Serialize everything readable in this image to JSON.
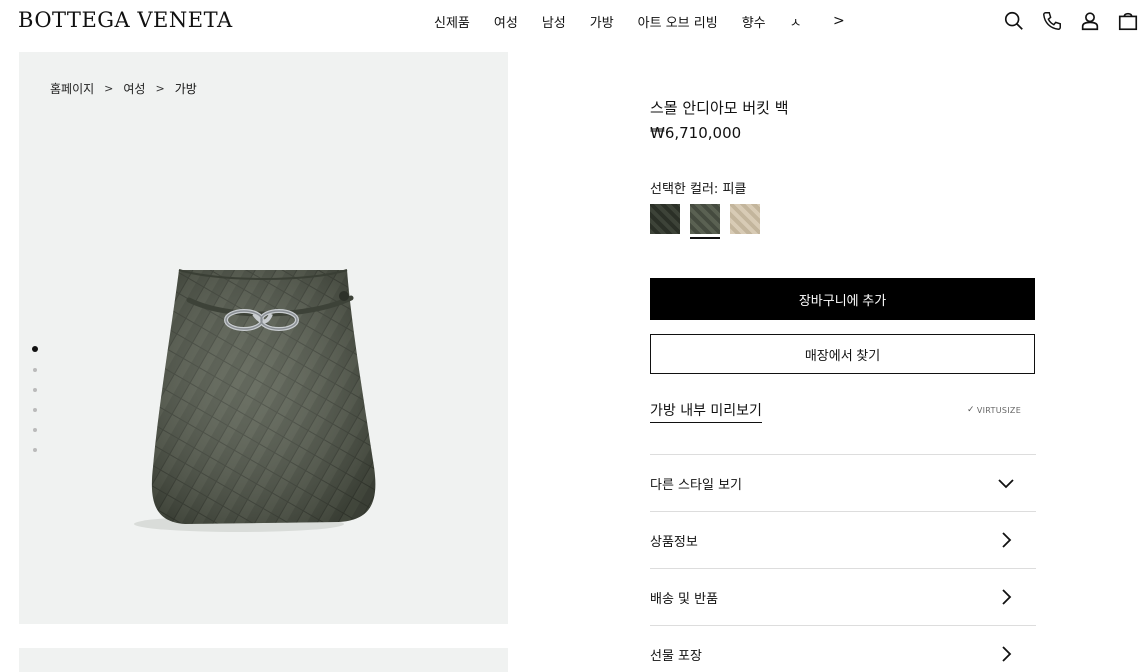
{
  "header": {
    "logo": "BOTTEGA VENETA",
    "nav": [
      "신제품",
      "여성",
      "남성",
      "가방",
      "아트 오브 리빙",
      "향수",
      "ㅅ"
    ],
    "nav_more": ">",
    "icons": [
      "search-icon",
      "phone-icon",
      "account-icon",
      "bag-icon"
    ]
  },
  "breadcrumb": {
    "items": [
      "홈페이지",
      "여성",
      "가방"
    ],
    "separator": ">"
  },
  "gallery": {
    "image_count": 6,
    "active_index": 0
  },
  "product": {
    "title": "스몰 안디아모 버킷 백",
    "price": "₩6,710,000",
    "color_label": "선택한 컬러: 피클",
    "swatches": [
      {
        "name": "dark-green",
        "color": "#3d4338"
      },
      {
        "name": "pickle",
        "color": "#5a6152",
        "selected": true
      },
      {
        "name": "beige",
        "color": "#d8cbb5"
      }
    ],
    "add_to_cart": "장바구니에 추가",
    "find_in_store": "매장에서 찾기",
    "preview_link": "가방 내부 미리보기",
    "virtusize": "VIRTUSIZE"
  },
  "accordion": [
    {
      "label": "다른 스타일 보기",
      "icon": "chevron-down-icon"
    },
    {
      "label": "상품정보",
      "icon": "chevron-right-icon"
    },
    {
      "label": "배송 및 반품",
      "icon": "chevron-right-icon"
    },
    {
      "label": "선물 포장",
      "icon": "chevron-right-icon"
    }
  ],
  "colors": {
    "gallery_bg": "#f0f2f1",
    "bag": "#555b4d",
    "primary_button": "#000000"
  }
}
